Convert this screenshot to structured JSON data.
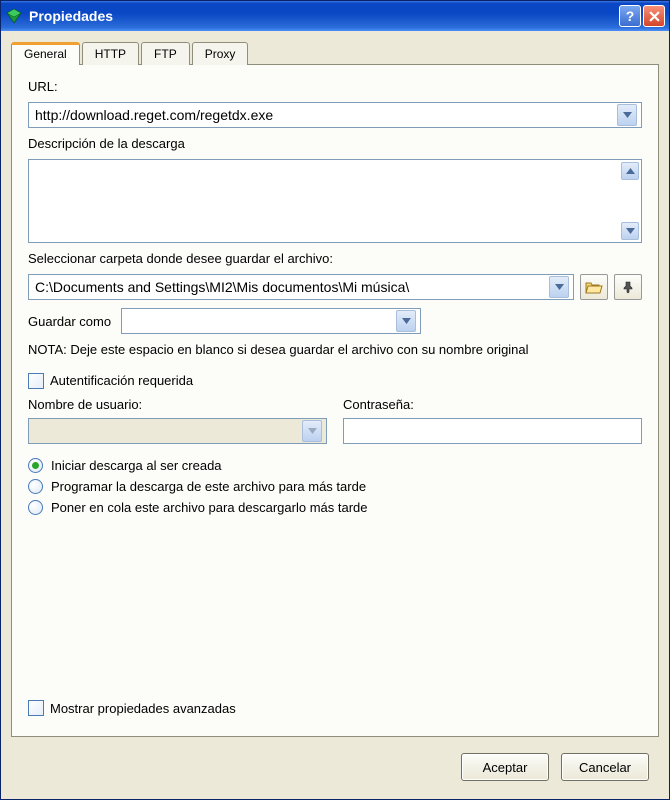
{
  "title": "Propiedades",
  "tabs": [
    "General",
    "HTTP",
    "FTP",
    "Proxy"
  ],
  "activeTab": 0,
  "general": {
    "url_label": "URL:",
    "url_value": "http://download.reget.com/regetdx.exe",
    "desc_label": "Descripción de la descarga",
    "desc_value": "",
    "folder_label": "Seleccionar carpeta donde desee guardar el archivo:",
    "folder_value": "C:\\Documents and Settings\\MI2\\Mis documentos\\Mi música\\",
    "saveas_label": "Guardar como",
    "saveas_value": "",
    "note": "NOTA: Deje este espacio en blanco si desea guardar el archivo con su nombre original",
    "auth_label": "Autentificación requerida",
    "auth_checked": false,
    "user_label": "Nombre de usuario:",
    "user_value": "",
    "pass_label": "Contraseña:",
    "pass_value": "",
    "radios": [
      "Iniciar descarga al ser creada",
      "Programar la descarga de este archivo para más tarde",
      "Poner en cola este archivo para descargarlo más tarde"
    ],
    "radio_selected": 0,
    "advanced_label": "Mostrar propiedades avanzadas",
    "advanced_checked": false
  },
  "buttons": {
    "accept": "Aceptar",
    "cancel": "Cancelar"
  }
}
